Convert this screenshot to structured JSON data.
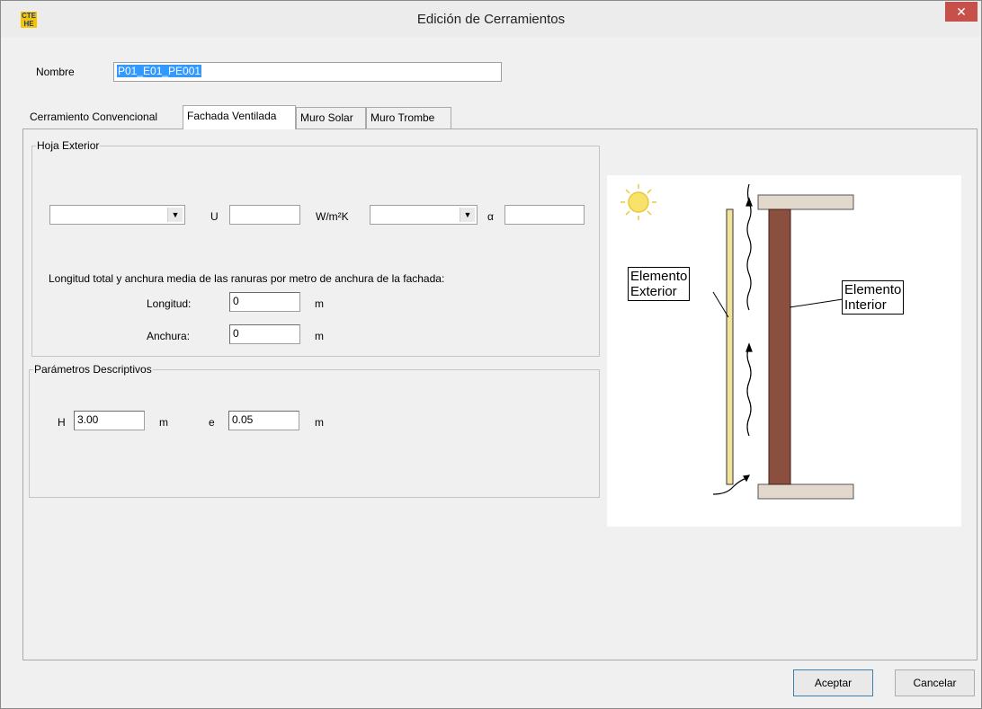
{
  "window": {
    "title": "Edición de Cerramientos",
    "app_icon_text_top": "CTE",
    "app_icon_text_bottom": "HE",
    "close_symbol": "✕"
  },
  "nombre": {
    "label": "Nombre",
    "value": "P01_E01_PE001"
  },
  "tabs": [
    {
      "label": "Cerramiento Convencional"
    },
    {
      "label": "Fachada Ventilada"
    },
    {
      "label": "Muro Solar"
    },
    {
      "label": "Muro Trombe"
    }
  ],
  "hoja_exterior": {
    "group_title": "Hoja Exterior",
    "u_label": "U",
    "u_value": "",
    "u_unit": "W/m²K",
    "alpha_label": "α",
    "alpha_value": "",
    "material_select": "",
    "color_select": "",
    "ranuras_text": "Longitud total y anchura media de las ranuras por metro de anchura de la fachada:",
    "longitud_label": "Longitud:",
    "longitud_value": "0",
    "longitud_unit": "m",
    "anchura_label": "Anchura:",
    "anchura_value": "0",
    "anchura_unit": "m"
  },
  "parametros": {
    "group_title": "Parámetros Descriptivos",
    "h_label": "H",
    "h_value": "3.00",
    "h_unit": "m",
    "e_label": "e",
    "e_value": "0.05",
    "e_unit": "m"
  },
  "diagram": {
    "exterior_label_line1": "Elemento",
    "exterior_label_line2": "Exterior",
    "interior_label_line1": "Elemento",
    "interior_label_line2": "Interior",
    "sun_color": "#f8e26a",
    "wall_color": "#8b4f3f",
    "cladding_color": "#f3e29a"
  },
  "buttons": {
    "accept": "Aceptar",
    "cancel": "Cancelar"
  }
}
